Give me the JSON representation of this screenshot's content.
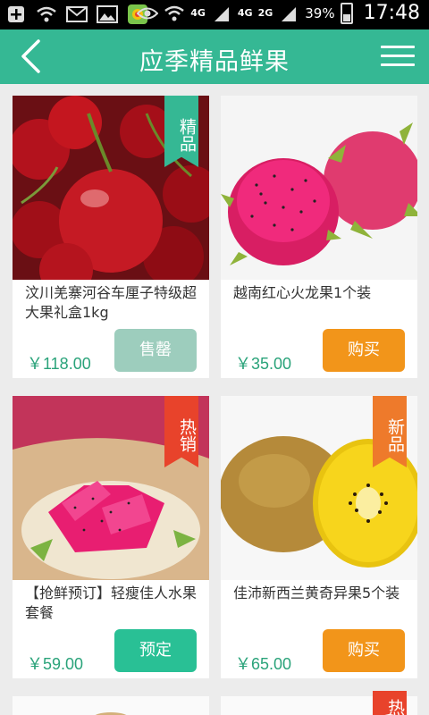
{
  "status_bar": {
    "network_1": "4G",
    "network_2": "4G",
    "network_3": "2G",
    "battery": "39%",
    "time": "17:48"
  },
  "header": {
    "title": "应季精品鲜果"
  },
  "products": [
    {
      "name": "汶川羌寨河谷车厘子特级超大果礼盒1kg",
      "price": "￥118.00",
      "button": "售罄",
      "badge": "精品"
    },
    {
      "name": "越南红心火龙果1个装",
      "price": "￥35.00",
      "button": "购买",
      "badge": ""
    },
    {
      "name": "【抢鲜预订】轻瘦佳人水果套餐",
      "price": "￥59.00",
      "button": "预定",
      "badge": "热销"
    },
    {
      "name": "佳沛新西兰黄奇异果5个装",
      "price": "￥65.00",
      "button": "购买",
      "badge": "新品"
    },
    {
      "name": "",
      "price": "",
      "button": "",
      "badge": ""
    },
    {
      "name": "",
      "price": "",
      "button": "",
      "badge": "热"
    }
  ],
  "colors": {
    "header_bg": "#35b894",
    "price": "#2aa37a",
    "btn_buy": "#f2951a",
    "btn_soldout": "#9dcdbd",
    "btn_reserve": "#29c095",
    "badge_teal": "#35b894",
    "badge_red": "#e8432b",
    "badge_orange": "#ee7a2b"
  }
}
